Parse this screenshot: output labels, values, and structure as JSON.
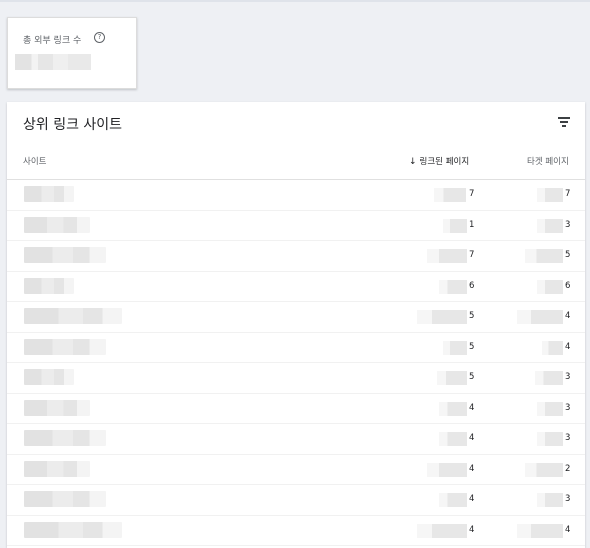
{
  "summary": {
    "title": "총 외부 링크 수",
    "help_icon": "help-circle-icon"
  },
  "panel": {
    "title": "상위 링크 사이트",
    "filter_icon": "filter-icon",
    "columns": {
      "site": "사이트",
      "linked_pages": "링크된 페이지",
      "target_pages": "타겟 페이지",
      "sort_icon": "arrow-down-icon"
    },
    "rows": [
      {
        "linked": "7",
        "target": "7"
      },
      {
        "linked": "1",
        "target": "3"
      },
      {
        "linked": "7",
        "target": "5"
      },
      {
        "linked": "6",
        "target": "6"
      },
      {
        "linked": "5",
        "target": "4"
      },
      {
        "linked": "5",
        "target": "4"
      },
      {
        "linked": "5",
        "target": "3"
      },
      {
        "linked": "4",
        "target": "3"
      },
      {
        "linked": "4",
        "target": "3"
      },
      {
        "linked": "4",
        "target": "2"
      },
      {
        "linked": "4",
        "target": "3"
      },
      {
        "linked": "4",
        "target": "4"
      }
    ]
  }
}
